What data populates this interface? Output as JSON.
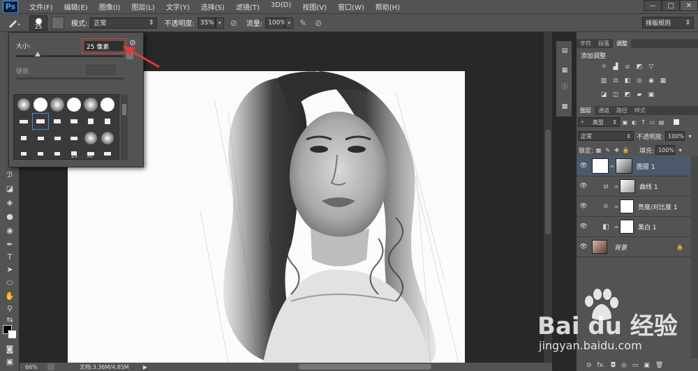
{
  "app": {
    "logo": "Ps",
    "menu": [
      "文件(F)",
      "编辑(E)",
      "图像(I)",
      "图层(L)",
      "文字(Y)",
      "选择(S)",
      "滤镜(T)",
      "3D(D)",
      "视图(V)",
      "窗口(W)",
      "帮助(H)"
    ],
    "window_controls": [
      "—",
      "□",
      "✕"
    ]
  },
  "options": {
    "brush_size_preview": "25",
    "mode_label": "模式:",
    "mode_value": "正常",
    "opacity_label": "不透明度:",
    "opacity_value": "35%",
    "flow_label": "流量:",
    "flow_value": "100%",
    "workspace": "排版规则"
  },
  "brush_popup": {
    "size_label": "大小:",
    "size_value": "25 像素",
    "hardness_label": "硬度:",
    "size_slider_fraction": 0.2,
    "preset_numbers": [
      "25",
      "50"
    ]
  },
  "status": {
    "zoom": "66%",
    "doc_size": "文档:3.36M/4.85M"
  },
  "panels": {
    "top_tabs": [
      "字符",
      "段落",
      "调整"
    ],
    "adjust_title": "添加调整",
    "layer_tabs": [
      "图层",
      "通道",
      "路径",
      "样式"
    ],
    "filter_type": "类型",
    "blend_mode": "正常",
    "opacity_label": "不透明度:",
    "opacity_value": "100%",
    "lock_label": "锁定:",
    "fill_label": "填充:",
    "fill_value": "100%",
    "layers": [
      {
        "name": "图层 1",
        "kind": "layer",
        "active": true
      },
      {
        "name": "曲线 1",
        "kind": "curves",
        "active": false
      },
      {
        "name": "亮度/对比度 1",
        "kind": "brightness",
        "active": false
      },
      {
        "name": "黑白 1",
        "kind": "bw",
        "active": false
      },
      {
        "name": "背景",
        "kind": "background",
        "active": false
      }
    ],
    "bottom_icons": [
      "⊝",
      "fx.",
      "◘",
      "◎",
      "▭",
      "▣",
      "🗑"
    ]
  },
  "watermark": {
    "brand": "Bai du 经验",
    "url": "jingyan.baidu.com"
  },
  "colors": {
    "accent_red": "#e53935",
    "active_layer": "#4c596b",
    "ui_gray": "#535353"
  }
}
